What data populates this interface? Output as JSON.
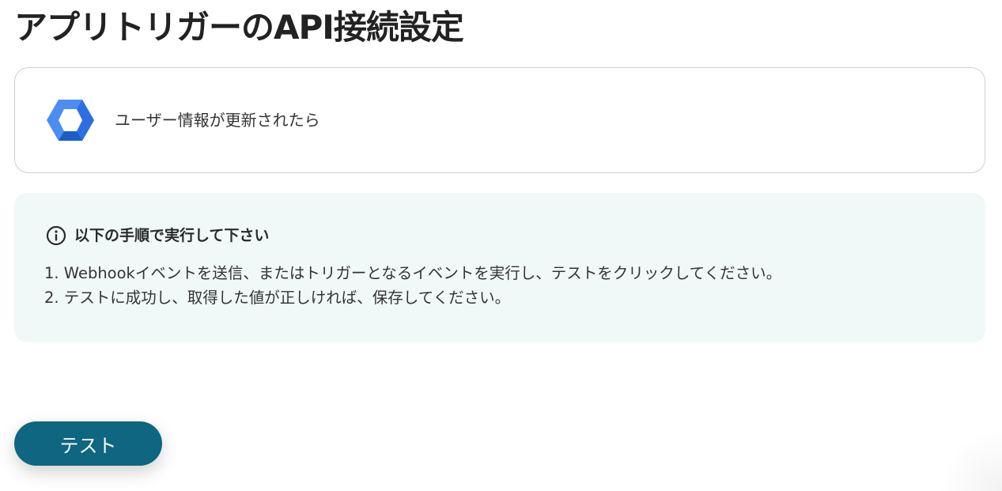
{
  "page": {
    "title": "アプリトリガーのAPI接続設定"
  },
  "trigger": {
    "icon": "google-workspace-hexagon-icon",
    "label": "ユーザー情報が更新されたら"
  },
  "instructions": {
    "icon": "info-icon",
    "title": "以下の手順で実行して下さい",
    "steps": [
      "1. Webhookイベントを送信、またはトリガーとなるイベントを実行し、テストをクリックしてください。",
      "2. テストに成功し、取得した値が正しければ、保存してください。"
    ]
  },
  "actions": {
    "test_label": "テスト"
  },
  "colors": {
    "accent": "#0e6680",
    "instruction_bg": "#f1f8f8",
    "icon_blue_light": "#4b8df0",
    "icon_blue_dark": "#1a5fc7"
  }
}
